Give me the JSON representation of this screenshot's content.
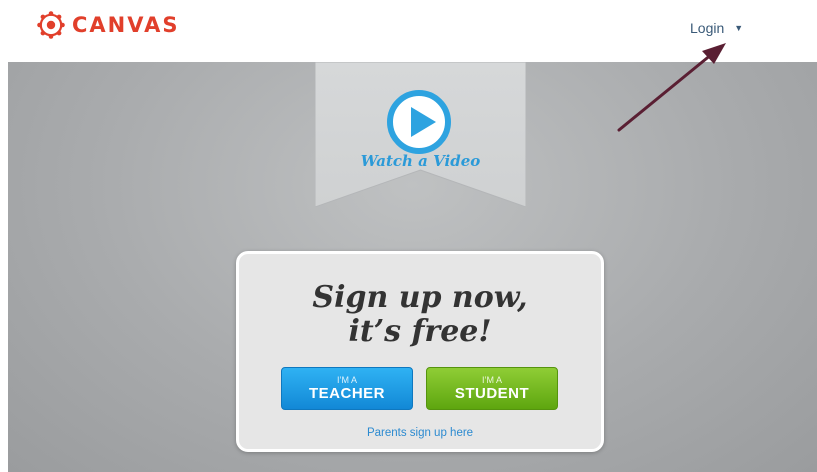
{
  "header": {
    "logo_text": "CANVAS",
    "login_label": "Login",
    "login_caret": "▼"
  },
  "hero": {
    "video_label": "Watch a Video"
  },
  "signup": {
    "headline_line1": "Sign up now,",
    "headline_line2": "it’s free!",
    "teacher_button": {
      "prefix": "I’M A",
      "label": "TEACHER"
    },
    "student_button": {
      "prefix": "I’M A",
      "label": "STUDENT"
    },
    "parents_link": "Parents sign up here"
  },
  "colors": {
    "brand_red": "#e13f2b",
    "teacher_blue": "#1a9be6",
    "student_green": "#76bb22",
    "link_blue": "#2b8ad0",
    "annotation_arrow": "#5a1f33"
  },
  "icons": {
    "logo": "canvas-logo-icon",
    "play": "play-icon",
    "caret": "chevron-down-icon",
    "annotation": "annotation-arrow-icon"
  }
}
